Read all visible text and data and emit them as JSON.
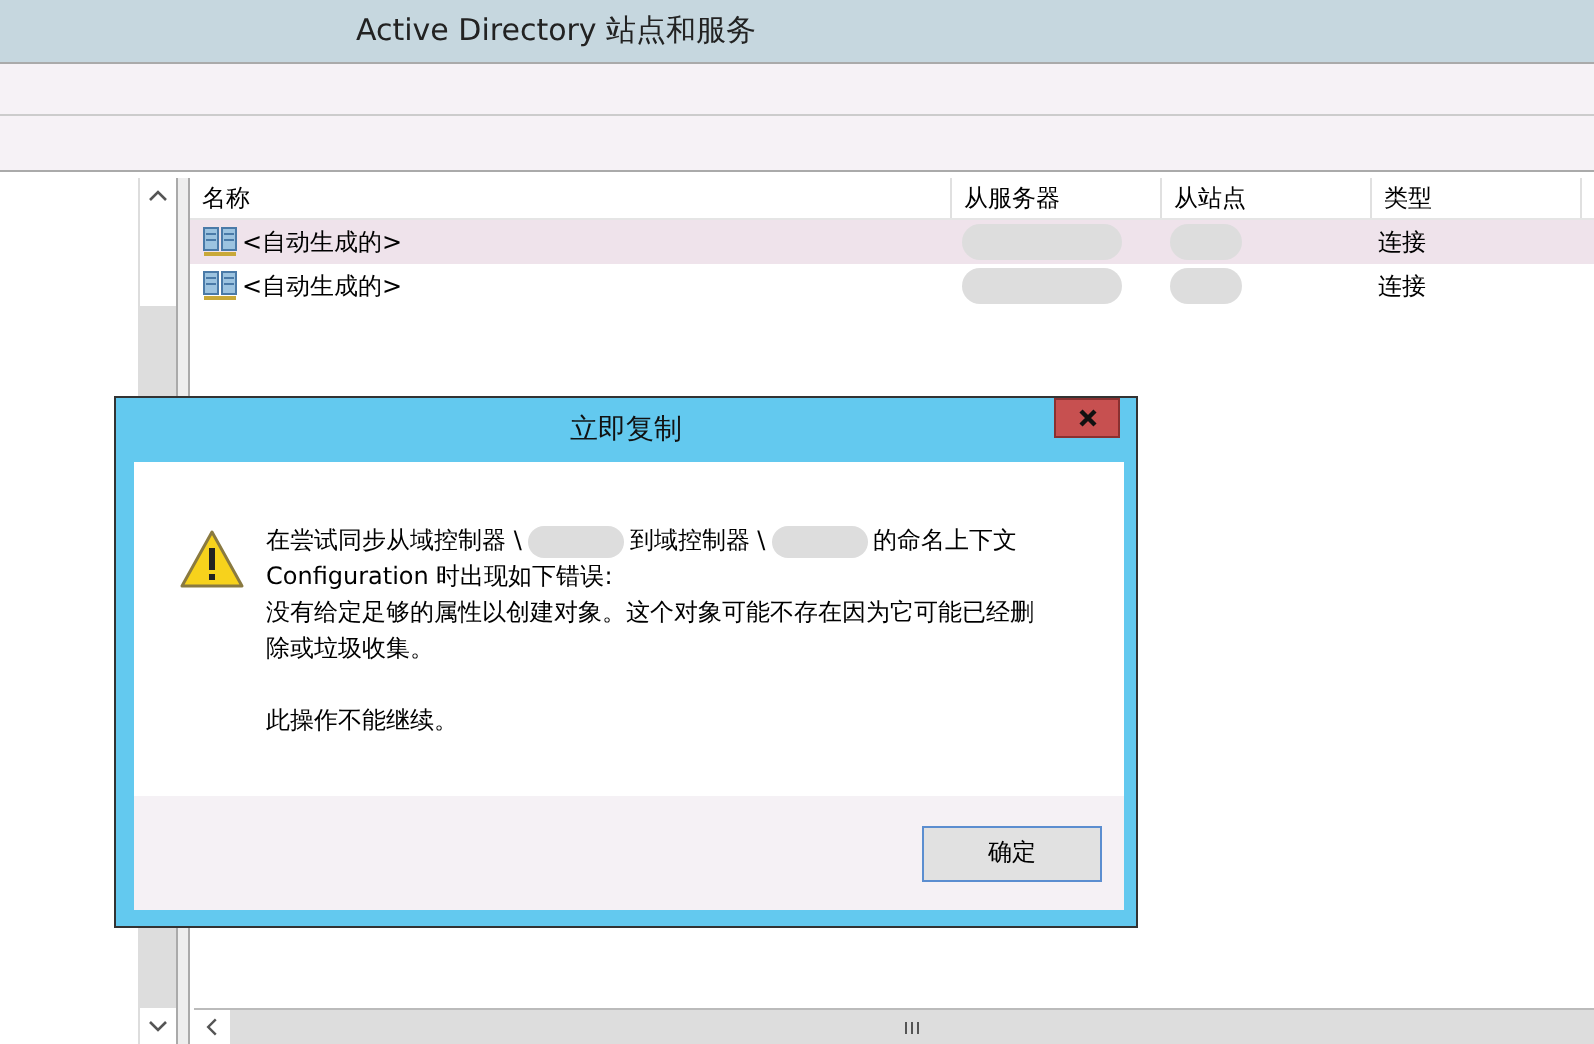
{
  "window": {
    "title": "Active Directory 站点和服务"
  },
  "table": {
    "columns": [
      "名称",
      "从服务器",
      "从站点",
      "类型"
    ],
    "rows": [
      {
        "name": "<自动生成的>",
        "type": "连接",
        "selected": true
      },
      {
        "name": "<自动生成的>",
        "type": "连接",
        "selected": false
      }
    ]
  },
  "dialog": {
    "title": "立即复制",
    "message": [
      [
        {
          "kind": "text",
          "text": "在尝试同步从域控制器 \\"
        },
        {
          "kind": "redacted"
        },
        {
          "kind": "text",
          "text": "到域控制器 \\"
        },
        {
          "kind": "redacted"
        },
        {
          "kind": "text",
          "text": "的命名上下文 Configuration 时出现如下错误:"
        }
      ],
      [
        {
          "kind": "text",
          "text": "没有给定足够的属性以创建对象。这个对象可能不存在因为它可能已经删除或垃圾收集。"
        }
      ],
      [
        {
          "kind": "text",
          "text": "此操作不能继续。"
        }
      ]
    ],
    "buttons": [
      "确定"
    ]
  }
}
